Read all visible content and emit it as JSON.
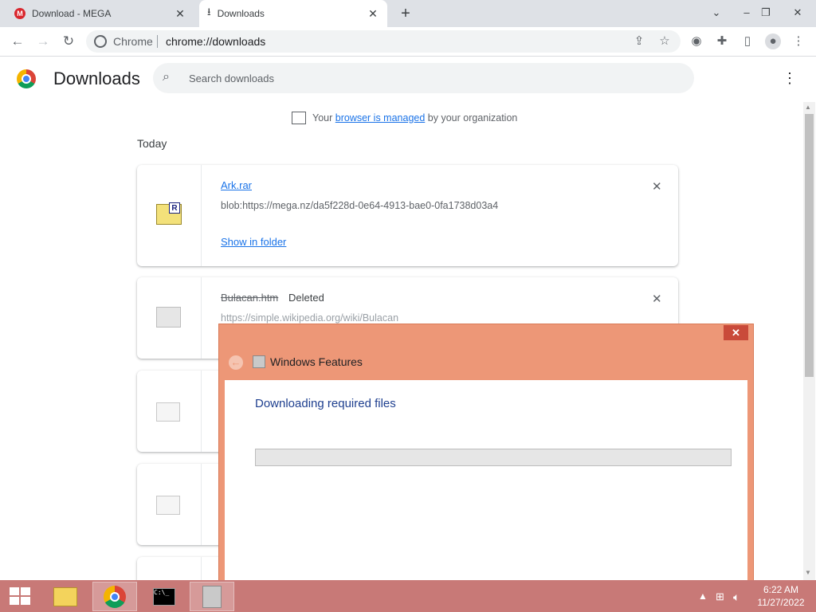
{
  "tabs": [
    {
      "title": "Download - MEGA",
      "icon": "mega-icon"
    },
    {
      "title": "Downloads",
      "icon": "download-icon"
    }
  ],
  "omnibox": {
    "site_label": "Chrome",
    "url": "chrome://downloads"
  },
  "page": {
    "title": "Downloads",
    "search_placeholder": "Search downloads",
    "managed": {
      "prefix": "Your",
      "link": "browser is managed",
      "suffix": "by your organization"
    },
    "section": "Today"
  },
  "downloads": [
    {
      "name": "Ark.rar",
      "url": "blob:https://mega.nz/da5f228d-0e64-4913-bae0-0fa1738d03a4",
      "action": "Show in folder"
    },
    {
      "name": "Bulacan.htm",
      "status": "Deleted",
      "url": "https://simple.wikipedia.org/wiki/Bulacan"
    }
  ],
  "dialog": {
    "title": "Windows Features",
    "heading": "Downloading required files",
    "progress": 0
  },
  "taskbar": {
    "time": "6:22 AM",
    "date": "11/27/2022"
  },
  "colors": {
    "accent": "#1a73e8",
    "dialog_frame": "#ed9777",
    "taskbar": "#c87977"
  }
}
